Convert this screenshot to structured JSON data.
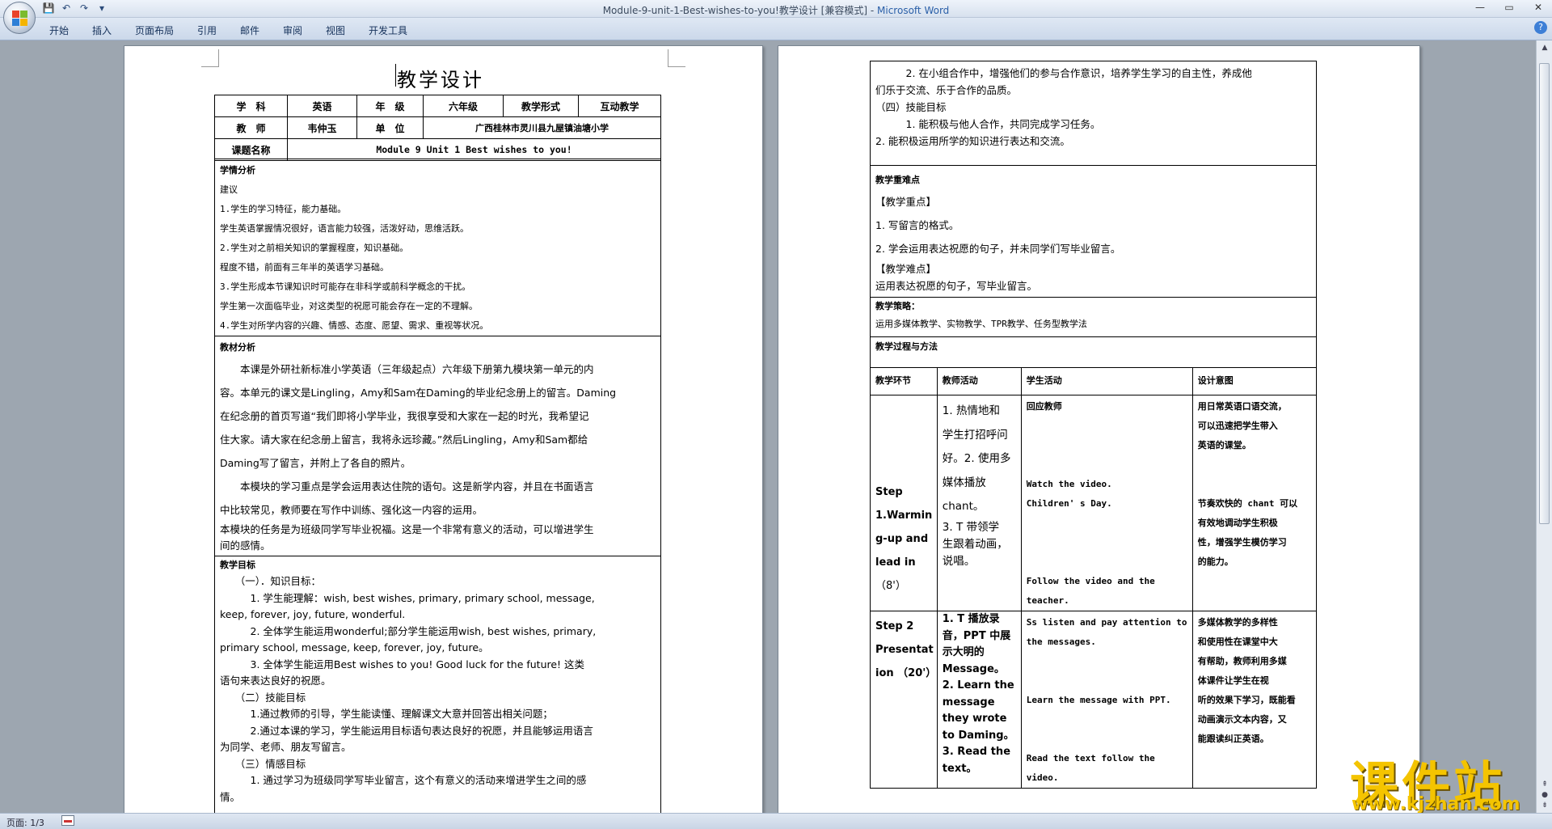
{
  "window": {
    "title": "Module-9-unit-1-Best-wishes-to-you!教学设计 [兼容模式] - ",
    "app": "Microsoft Word",
    "controls": [
      "—",
      "▭",
      "✕"
    ]
  },
  "qat": {
    "save": "💾",
    "undo": "↶",
    "redo": "↷",
    "more": "▾"
  },
  "ribbon": {
    "tabs": [
      "开始",
      "插入",
      "页面布局",
      "引用",
      "邮件",
      "审阅",
      "视图",
      "开发工具"
    ],
    "help": "?"
  },
  "status": {
    "page": "页面: 1/3"
  },
  "page1": {
    "title": "教学设计",
    "row1": [
      "学　科",
      "英语",
      "年　级",
      "六年级",
      "教学形式",
      "互动教学"
    ],
    "row2": [
      "教　师",
      "韦仲玉",
      "单　位",
      "广西桂林市灵川县九屋镇油塘小学"
    ],
    "row3": [
      "课题名称",
      "Module 9 Unit 1 Best wishes to you!"
    ],
    "xueqing": {
      "heading": "学情分析",
      "lines": [
        "建议",
        "1.学生的学习特征，能力基础。",
        "学生英语掌握情况很好，语言能力较强，活泼好动，思维活跃。",
        "2.学生对之前相关知识的掌握程度，知识基础。",
        "程度不错，前面有三年半的英语学习基础。",
        "3.学生形成本节课知识时可能存在非科学或前科学概念的干扰。",
        "学生第一次面临毕业，对这类型的祝愿可能会存在一定的不理解。",
        "4.学生对所学内容的兴趣、情感、态度、愿望、需求、重视等状况。"
      ]
    },
    "jiaocai": {
      "heading": "教材分析",
      "lines": [
        "　　本课是外研社新标准小学英语（三年级起点）六年级下册第九模块第一单元的内",
        "容。本单元的课文是Lingling，Amy和Sam在Daming的毕业纪念册上的留言。Daming",
        "在纪念册的首页写道“我们即将小学毕业，我很享受和大家在一起的时光，我希望记",
        "住大家。请大家在纪念册上留言，我将永远珍藏。”然后Lingling，Amy和Sam都给",
        "Daming写了留言，并附上了各自的照片。",
        "　　本模块的学习重点是学会运用表达住院的语句。这是新学内容，并且在书面语言",
        "中比较常见，教师要在写作中训练、强化这一内容的运用。",
        "本模块的任务是为班级同学写毕业祝福。这是一个非常有意义的活动，可以增进学生",
        "间的感情。"
      ]
    },
    "mubiao": {
      "heading": "教学目标",
      "lines": [
        "　　（一）．知识目标：",
        "　　　1. 学生能理解：wish, best wishes, primary, primary school, message,",
        "keep, forever, joy, future, wonderful.",
        "　　　2. 全体学生能运用wonderful;部分学生能运用wish, best wishes, primary,",
        "primary school, message, keep, forever, joy, future。",
        "　　　3. 全体学生能运用Best wishes to you! Good luck for the future! 这类",
        "语句来表达良好的祝愿。",
        "　　（二）技能目标",
        "　　　1.通过教师的引导，学生能读懂、理解课文大意并回答出相关问题；",
        "　　　2.通过本课的学习，学生能运用目标语句表达良好的祝愿，并且能够运用语言",
        "为同学、老师、朋友写留言。",
        "　　（三）情感目标",
        "　　　1. 通过学习为班级同学写毕业留言，这个有意义的活动来增进学生之间的感",
        "情。"
      ]
    }
  },
  "page2": {
    "top": [
      "　　　2. 在小组合作中，增强他们的参与合作意识，培养学生学习的自主性，养成他",
      "们乐于交流、乐于合作的品质。",
      "（四）技能目标",
      "　　　1. 能积极与他人合作，共同完成学习任务。",
      "2. 能积极运用所学的知识进行表达和交流。"
    ],
    "zhongdian": {
      "heading": "教学重难点",
      "lines": [
        "【教学重点】",
        "1. 写留言的格式。",
        "2. 学会运用表达祝愿的句子，并未同学们写毕业留言。",
        "【教学难点】",
        "运用表达祝愿的句子，写毕业留言。"
      ]
    },
    "celue": {
      "heading": "教学策略：",
      "text": "运用多媒体教学、实物教学、TPR教学、任务型教学法"
    },
    "guocheng": {
      "heading": "教学过程与方法"
    },
    "process_headers": [
      "教学环节",
      "教师活动",
      "学生活动",
      "设计意图"
    ],
    "step1": {
      "stage": [
        "Step",
        "1.Warmin",
        "g-up and",
        "lead in",
        "（8'）"
      ],
      "teacher": [
        "1. 热情地和",
        "学生打招呼问",
        "好。2. 使用多",
        "媒体播放",
        "chant。",
        "3. T 带领学",
        "生跟着动画，",
        "说唱。"
      ],
      "student": [
        "回应教师",
        "Watch the video.",
        "Children' s Day.",
        "Follow  the  video  and  the",
        "teacher."
      ],
      "intent": [
        "用日常英语口语交流，",
        "可以迅速把学生带入",
        "英语的课堂。",
        "节奏欢快的 chant 可以",
        "有效地调动学生积极",
        "性，增强学生模仿学习",
        "的能力。"
      ]
    },
    "step2": {
      "stage": [
        "Step    2",
        "Presentat",
        "ion （20'）"
      ],
      "teacher": [
        "1. T 播放录",
        "音，PPT 中展",
        "示大明的",
        "Message。",
        "2. Learn the",
        "message",
        "they  wrote",
        "to Daming。",
        "3. Read  the",
        "text。"
      ],
      "student": [
        "Ss listen and pay attention to",
        "the messages.",
        "Learn the message with PPT.",
        "Read  the  text  follow  the",
        "video."
      ],
      "intent": [
        "多媒体教学的多样性",
        "和使用性在课堂中大",
        "有帮助，教师利用多媒",
        "体课件让学生在视",
        "听的效果下学习，既能看",
        "动画演示文本内容，又",
        "能跟读纠正英语。"
      ]
    }
  },
  "watermark": {
    "text": "课件站",
    "url": "www.kjzhan.com"
  }
}
